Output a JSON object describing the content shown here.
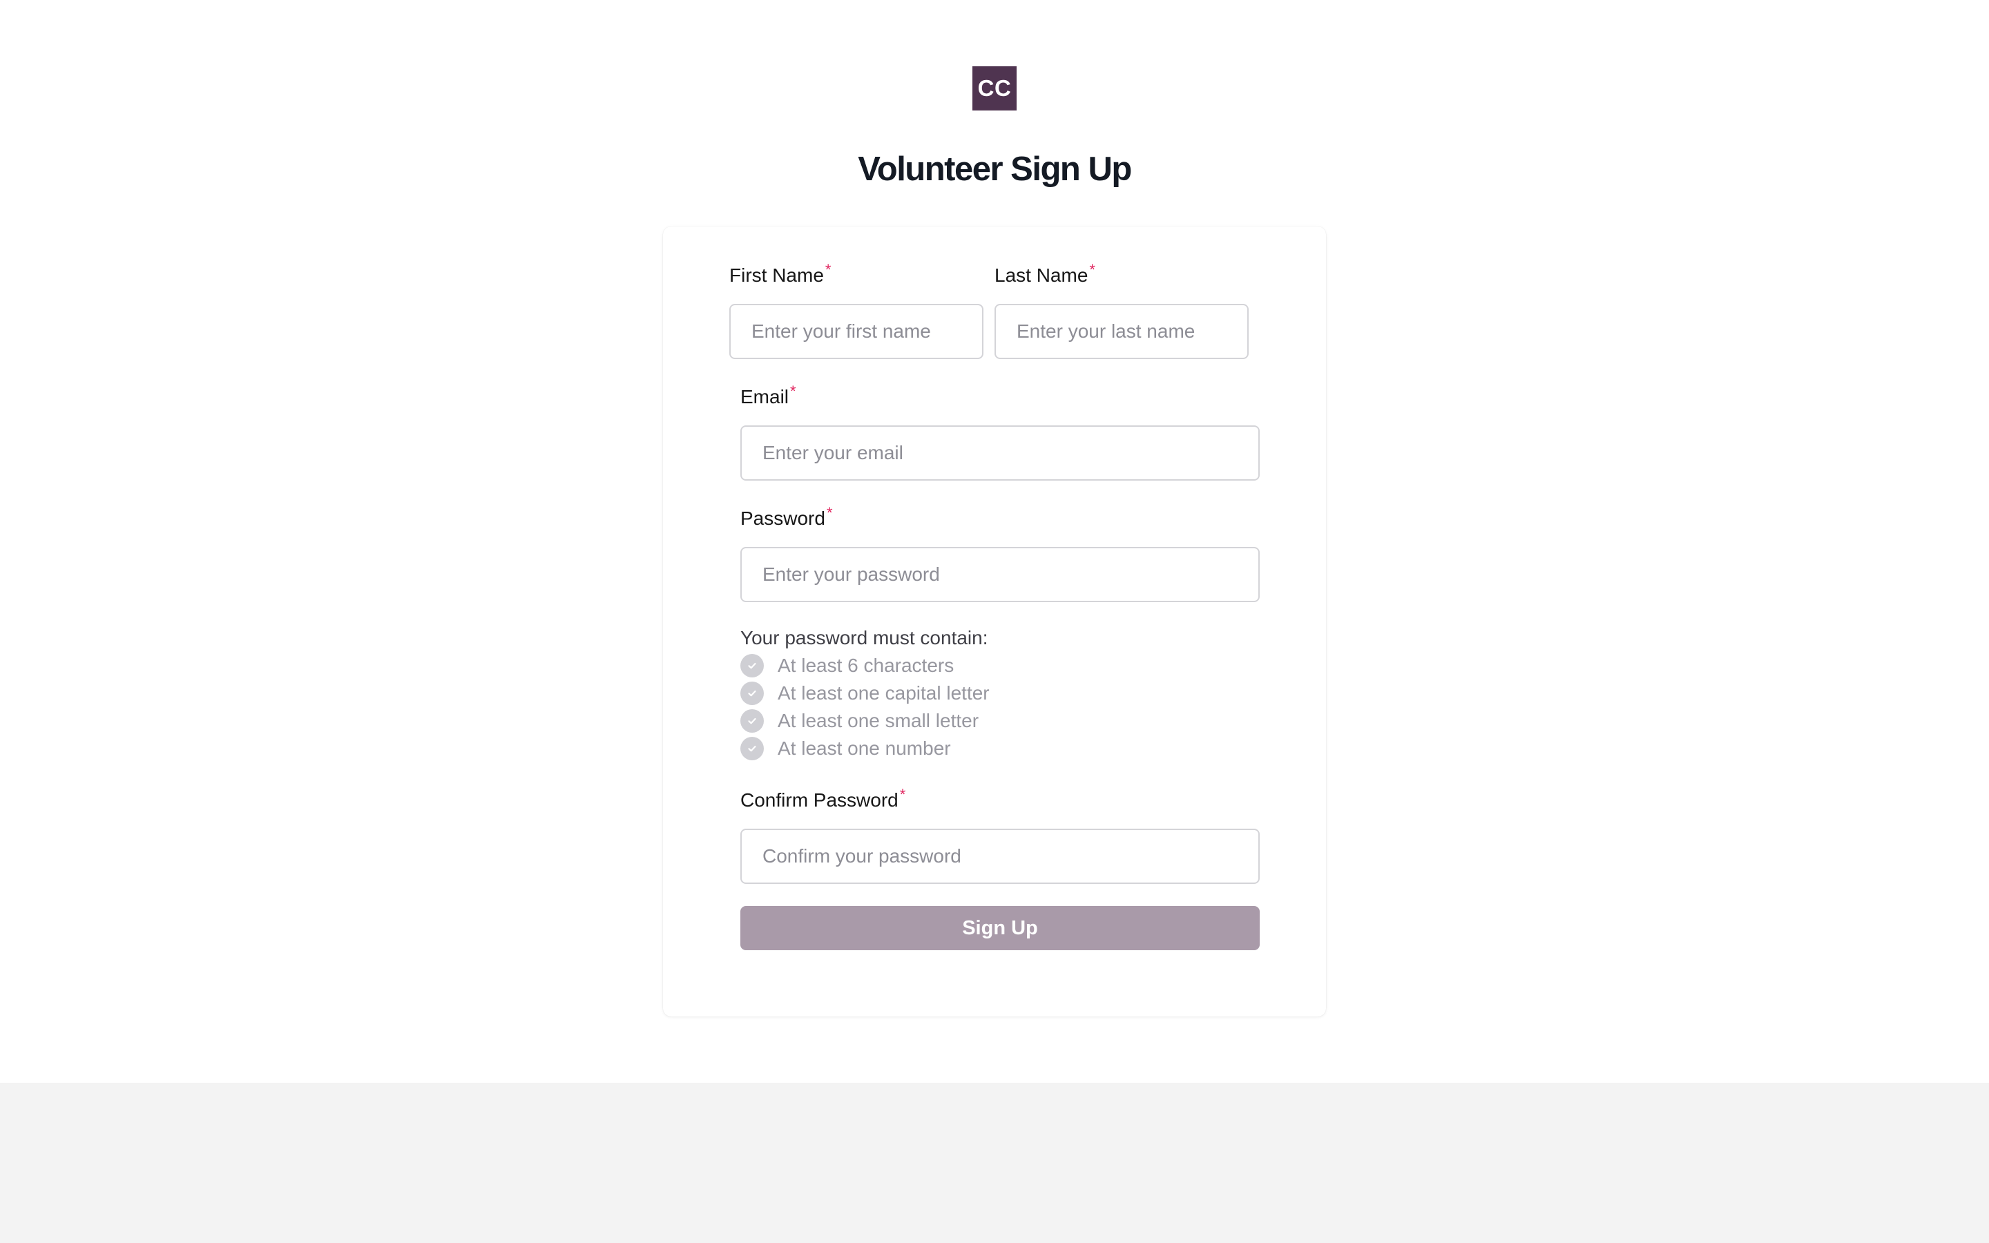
{
  "brand": {
    "logo_text": "CC",
    "color": "#4f3450"
  },
  "page": {
    "title": "Volunteer Sign Up"
  },
  "form": {
    "required_marker": "*",
    "first_name": {
      "label": "First Name",
      "placeholder": "Enter your first name",
      "value": ""
    },
    "last_name": {
      "label": "Last Name",
      "placeholder": "Enter your last name",
      "value": ""
    },
    "email": {
      "label": "Email",
      "placeholder": "Enter your email",
      "value": ""
    },
    "password": {
      "label": "Password",
      "placeholder": "Enter your password",
      "value": ""
    },
    "password_requirements": {
      "heading": "Your password must contain:",
      "icon": "check-circle-icon",
      "rules": [
        {
          "text": "At least 6 characters",
          "met": false
        },
        {
          "text": "At least one capital letter",
          "met": false
        },
        {
          "text": "At least one small letter",
          "met": false
        },
        {
          "text": "At least one number",
          "met": false
        }
      ]
    },
    "confirm_password": {
      "label": "Confirm Password",
      "placeholder": "Confirm your password",
      "value": ""
    },
    "submit": {
      "label": "Sign Up",
      "enabled": false,
      "color": "#a99aa9"
    }
  },
  "colors": {
    "required_asterisk": "#e0245e",
    "footer_background": "#f3f3f3"
  }
}
